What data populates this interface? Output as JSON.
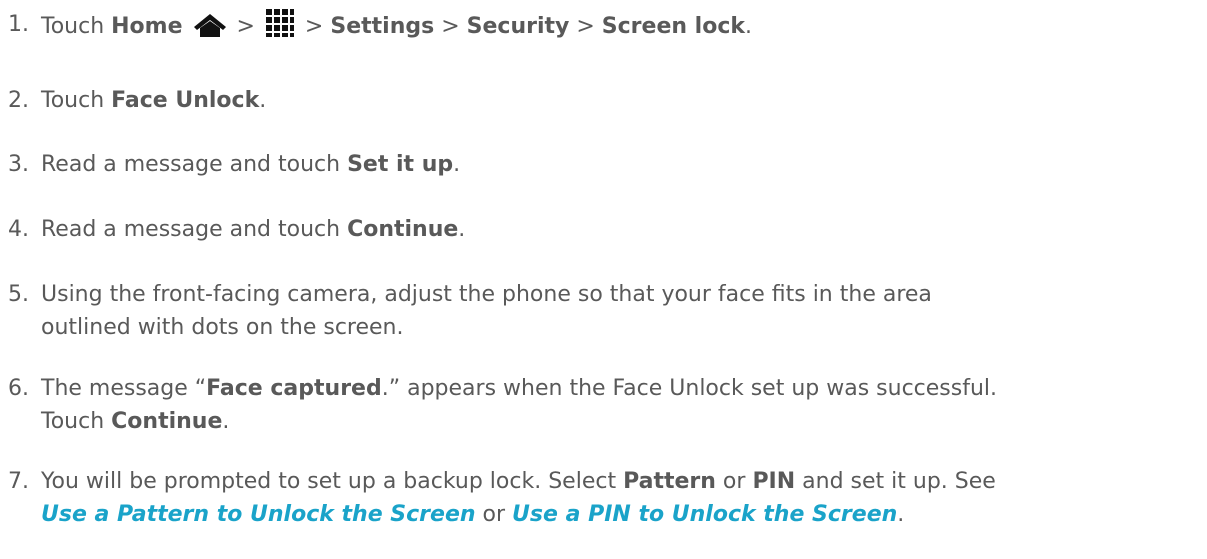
{
  "steps": [
    {
      "num": "1.",
      "prefix": "Touch ",
      "home": "Home",
      "sep1": " > ",
      "sep2": " > ",
      "settings": "Settings",
      "sep3": " > ",
      "security": "Security",
      "sep4": " > ",
      "screen_lock": "Screen lock",
      "end": ".",
      "home_icon": "home-icon",
      "apps_icon": "apps-grid-icon"
    },
    {
      "num": "2.",
      "prefix": "Touch ",
      "bold": "Face Unlock",
      "end": "."
    },
    {
      "num": "3.",
      "prefix": "Read a message and touch ",
      "bold": "Set it up",
      "end": "."
    },
    {
      "num": "4.",
      "prefix": "Read a message and touch ",
      "bold": "Continue",
      "end": "."
    },
    {
      "num": "5.",
      "line1": "Using the front-facing camera, adjust the phone so that your face fits in the area",
      "line2": "outlined with dots on the screen."
    },
    {
      "num": "6.",
      "prefix": "The message “",
      "bold": "Face captured",
      "mid": ".” appears when the Face Unlock set up was successful.",
      "line2_prefix": "Touch ",
      "line2_bold": "Continue",
      "line2_end": "."
    },
    {
      "num": "7.",
      "prefix": "You will be prompted to set up a backup lock. Select ",
      "bold1": "Pattern",
      "or1": " or ",
      "bold2": "PIN",
      "suffix": " and set it up. See",
      "link1": "Use a Pattern to Unlock the Screen",
      "or2": " or ",
      "link2": "Use a PIN to Unlock the Screen",
      "end": "."
    }
  ],
  "colors": {
    "text": "#595959",
    "link": "#1aa3c9",
    "background": "#ffffff"
  }
}
